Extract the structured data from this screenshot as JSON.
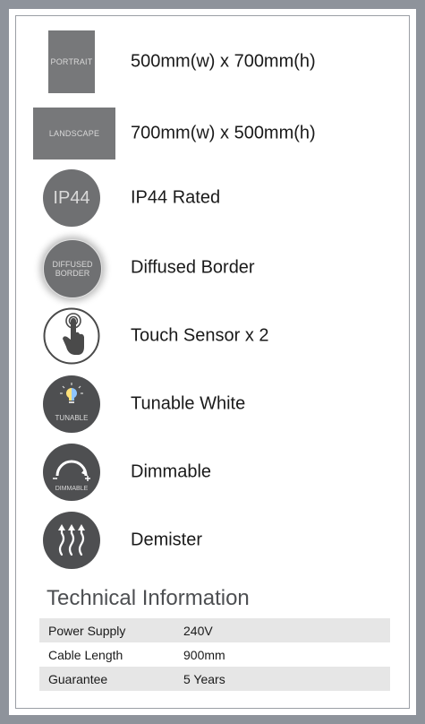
{
  "features": [
    {
      "icon_text": "PORTRAIT",
      "icon": "portrait-icon",
      "label": "500mm(w) x 700mm(h)"
    },
    {
      "icon_text": "LANDSCAPE",
      "icon": "landscape-icon",
      "label": "700mm(w) x 500mm(h)"
    },
    {
      "icon_text": "IP44",
      "icon": "ip44-icon",
      "label": "IP44 Rated"
    },
    {
      "icon_text_line1": "DIFFUSED",
      "icon_text_line2": "BORDER",
      "icon": "diffused-border-icon",
      "label": "Diffused Border"
    },
    {
      "icon": "touch-sensor-icon",
      "label": "Touch Sensor x 2"
    },
    {
      "icon_text": "TUNABLE",
      "icon": "tunable-white-icon",
      "label": "Tunable White"
    },
    {
      "icon_text": "DIMMABLE",
      "icon": "dimmable-icon",
      "label": "Dimmable"
    },
    {
      "icon": "demister-icon",
      "label": "Demister"
    }
  ],
  "technical": {
    "title": "Technical Information",
    "rows": [
      {
        "key": "Power Supply",
        "value": "240V"
      },
      {
        "key": "Cable Length",
        "value": "900mm"
      },
      {
        "key": "Guarantee",
        "value": "5 Years"
      }
    ]
  },
  "colors": {
    "page_bg": "#8e939b",
    "panel_bg": "#ffffff",
    "icon_bg": "#6f7072",
    "row_stripe": "#e6e6e6"
  }
}
